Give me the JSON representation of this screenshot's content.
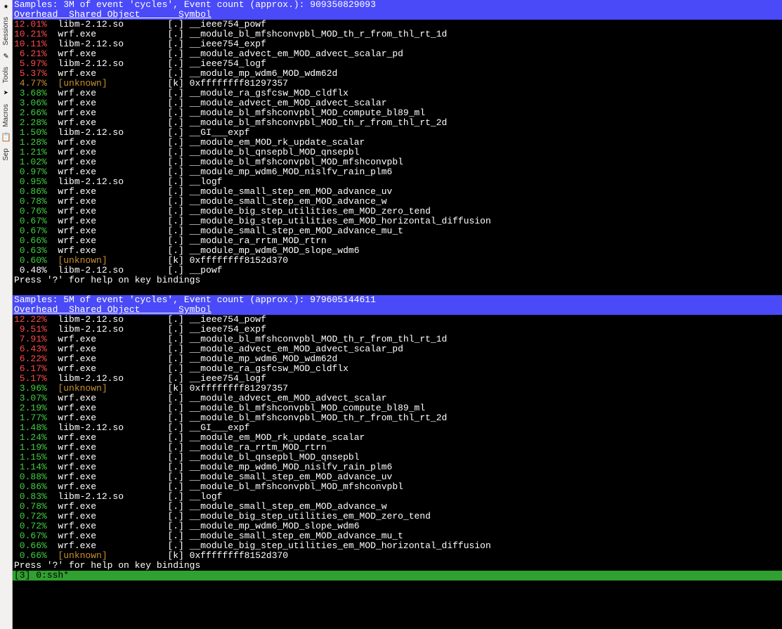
{
  "toolbar": {
    "labels": [
      "Sessions",
      "Tools",
      "Macros",
      "Sep"
    ],
    "icons": [
      "★",
      "✎",
      "➤",
      "📋"
    ]
  },
  "col_header": "Overhead  Shared Object       Symbol",
  "footer": "Press '?' for help on key bindings",
  "status_bar": "[3] 0:ssh*",
  "pane_top": {
    "title": "Samples: 3M of event 'cycles', Event count (approx.): 909350829093",
    "rows": [
      {
        "pct": "12.01%",
        "cls": "r",
        "obj": "libm-2.12.so",
        "oc": "obj",
        "k": ".",
        "sym": "__ieee754_powf"
      },
      {
        "pct": "10.21%",
        "cls": "r",
        "obj": "wrf.exe",
        "oc": "obj",
        "k": ".",
        "sym": "__module_bl_mfshconvpbl_MOD_th_r_from_thl_rt_1d"
      },
      {
        "pct": "10.11%",
        "cls": "r",
        "obj": "libm-2.12.so",
        "oc": "obj",
        "k": ".",
        "sym": "__ieee754_expf"
      },
      {
        "pct": " 6.21%",
        "cls": "r",
        "obj": "wrf.exe",
        "oc": "obj",
        "k": ".",
        "sym": "__module_advect_em_MOD_advect_scalar_pd"
      },
      {
        "pct": " 5.97%",
        "cls": "r",
        "obj": "libm-2.12.so",
        "oc": "obj",
        "k": ".",
        "sym": "__ieee754_logf"
      },
      {
        "pct": " 5.37%",
        "cls": "r",
        "obj": "wrf.exe",
        "oc": "obj",
        "k": ".",
        "sym": "__module_mp_wdm6_MOD_wdm62d"
      },
      {
        "pct": " 4.77%",
        "cls": "o",
        "obj": "[unknown]",
        "oc": "obj-unk",
        "k": "k",
        "sym": "0xffffffff81297357"
      },
      {
        "pct": " 3.68%",
        "cls": "g",
        "obj": "wrf.exe",
        "oc": "obj",
        "k": ".",
        "sym": "__module_ra_gsfcsw_MOD_cldflx"
      },
      {
        "pct": " 3.06%",
        "cls": "g",
        "obj": "wrf.exe",
        "oc": "obj",
        "k": ".",
        "sym": "__module_advect_em_MOD_advect_scalar"
      },
      {
        "pct": " 2.66%",
        "cls": "g",
        "obj": "wrf.exe",
        "oc": "obj",
        "k": ".",
        "sym": "__module_bl_mfshconvpbl_MOD_compute_bl89_ml"
      },
      {
        "pct": " 2.28%",
        "cls": "g",
        "obj": "wrf.exe",
        "oc": "obj",
        "k": ".",
        "sym": "__module_bl_mfshconvpbl_MOD_th_r_from_thl_rt_2d"
      },
      {
        "pct": " 1.50%",
        "cls": "g",
        "obj": "libm-2.12.so",
        "oc": "obj",
        "k": ".",
        "sym": "__GI___expf"
      },
      {
        "pct": " 1.28%",
        "cls": "g",
        "obj": "wrf.exe",
        "oc": "obj",
        "k": ".",
        "sym": "__module_em_MOD_rk_update_scalar"
      },
      {
        "pct": " 1.21%",
        "cls": "g",
        "obj": "wrf.exe",
        "oc": "obj",
        "k": ".",
        "sym": "__module_bl_qnsepbl_MOD_qnsepbl"
      },
      {
        "pct": " 1.02%",
        "cls": "g",
        "obj": "wrf.exe",
        "oc": "obj",
        "k": ".",
        "sym": "__module_bl_mfshconvpbl_MOD_mfshconvpbl"
      },
      {
        "pct": " 0.97%",
        "cls": "g",
        "obj": "wrf.exe",
        "oc": "obj",
        "k": ".",
        "sym": "__module_mp_wdm6_MOD_nislfv_rain_plm6"
      },
      {
        "pct": " 0.95%",
        "cls": "g",
        "obj": "libm-2.12.so",
        "oc": "obj",
        "k": ".",
        "sym": "__logf"
      },
      {
        "pct": " 0.86%",
        "cls": "g",
        "obj": "wrf.exe",
        "oc": "obj",
        "k": ".",
        "sym": "__module_small_step_em_MOD_advance_uv"
      },
      {
        "pct": " 0.78%",
        "cls": "g",
        "obj": "wrf.exe",
        "oc": "obj",
        "k": ".",
        "sym": "__module_small_step_em_MOD_advance_w"
      },
      {
        "pct": " 0.76%",
        "cls": "g",
        "obj": "wrf.exe",
        "oc": "obj",
        "k": ".",
        "sym": "__module_big_step_utilities_em_MOD_zero_tend"
      },
      {
        "pct": " 0.67%",
        "cls": "g",
        "obj": "wrf.exe",
        "oc": "obj",
        "k": ".",
        "sym": "__module_big_step_utilities_em_MOD_horizontal_diffusion"
      },
      {
        "pct": " 0.67%",
        "cls": "g",
        "obj": "wrf.exe",
        "oc": "obj",
        "k": ".",
        "sym": "__module_small_step_em_MOD_advance_mu_t"
      },
      {
        "pct": " 0.66%",
        "cls": "g",
        "obj": "wrf.exe",
        "oc": "obj",
        "k": ".",
        "sym": "__module_ra_rrtm_MOD_rtrn"
      },
      {
        "pct": " 0.63%",
        "cls": "g",
        "obj": "wrf.exe",
        "oc": "obj",
        "k": ".",
        "sym": "__module_mp_wdm6_MOD_slope_wdm6"
      },
      {
        "pct": " 0.60%",
        "cls": "g",
        "obj": "[unknown]",
        "oc": "obj-unk",
        "k": "k",
        "sym": "0xffffffff8152d370"
      },
      {
        "pct": " 0.48%",
        "cls": "w",
        "obj": "libm-2.12.so",
        "oc": "obj",
        "k": ".",
        "sym": "__powf"
      }
    ]
  },
  "pane_bottom": {
    "title": "Samples: 5M of event 'cycles', Event count (approx.): 979605144611",
    "rows": [
      {
        "pct": "12.22%",
        "cls": "r",
        "obj": "libm-2.12.so",
        "oc": "obj",
        "k": ".",
        "sym": "__ieee754_powf"
      },
      {
        "pct": " 9.51%",
        "cls": "r",
        "obj": "libm-2.12.so",
        "oc": "obj",
        "k": ".",
        "sym": "__ieee754_expf"
      },
      {
        "pct": " 7.91%",
        "cls": "r",
        "obj": "wrf.exe",
        "oc": "obj",
        "k": ".",
        "sym": "__module_bl_mfshconvpbl_MOD_th_r_from_thl_rt_1d"
      },
      {
        "pct": " 6.43%",
        "cls": "r",
        "obj": "wrf.exe",
        "oc": "obj",
        "k": ".",
        "sym": "__module_advect_em_MOD_advect_scalar_pd"
      },
      {
        "pct": " 6.22%",
        "cls": "r",
        "obj": "wrf.exe",
        "oc": "obj",
        "k": ".",
        "sym": "__module_mp_wdm6_MOD_wdm62d"
      },
      {
        "pct": " 6.17%",
        "cls": "r",
        "obj": "wrf.exe",
        "oc": "obj",
        "k": ".",
        "sym": "__module_ra_gsfcsw_MOD_cldflx"
      },
      {
        "pct": " 5.17%",
        "cls": "r",
        "obj": "libm-2.12.so",
        "oc": "obj",
        "k": ".",
        "sym": "__ieee754_logf"
      },
      {
        "pct": " 3.96%",
        "cls": "g",
        "obj": "[unknown]",
        "oc": "obj-unk",
        "k": "k",
        "sym": "0xffffffff81297357"
      },
      {
        "pct": " 3.07%",
        "cls": "g",
        "obj": "wrf.exe",
        "oc": "obj",
        "k": ".",
        "sym": "__module_advect_em_MOD_advect_scalar"
      },
      {
        "pct": " 2.19%",
        "cls": "g",
        "obj": "wrf.exe",
        "oc": "obj",
        "k": ".",
        "sym": "__module_bl_mfshconvpbl_MOD_compute_bl89_ml"
      },
      {
        "pct": " 1.77%",
        "cls": "g",
        "obj": "wrf.exe",
        "oc": "obj",
        "k": ".",
        "sym": "__module_bl_mfshconvpbl_MOD_th_r_from_thl_rt_2d"
      },
      {
        "pct": " 1.48%",
        "cls": "g",
        "obj": "libm-2.12.so",
        "oc": "obj",
        "k": ".",
        "sym": "__GI___expf"
      },
      {
        "pct": " 1.24%",
        "cls": "g",
        "obj": "wrf.exe",
        "oc": "obj",
        "k": ".",
        "sym": "__module_em_MOD_rk_update_scalar"
      },
      {
        "pct": " 1.19%",
        "cls": "g",
        "obj": "wrf.exe",
        "oc": "obj",
        "k": ".",
        "sym": "__module_ra_rrtm_MOD_rtrn"
      },
      {
        "pct": " 1.15%",
        "cls": "g",
        "obj": "wrf.exe",
        "oc": "obj",
        "k": ".",
        "sym": "__module_bl_qnsepbl_MOD_qnsepbl"
      },
      {
        "pct": " 1.14%",
        "cls": "g",
        "obj": "wrf.exe",
        "oc": "obj",
        "k": ".",
        "sym": "__module_mp_wdm6_MOD_nislfv_rain_plm6"
      },
      {
        "pct": " 0.88%",
        "cls": "g",
        "obj": "wrf.exe",
        "oc": "obj",
        "k": ".",
        "sym": "__module_small_step_em_MOD_advance_uv"
      },
      {
        "pct": " 0.86%",
        "cls": "g",
        "obj": "wrf.exe",
        "oc": "obj",
        "k": ".",
        "sym": "__module_bl_mfshconvpbl_MOD_mfshconvpbl"
      },
      {
        "pct": " 0.83%",
        "cls": "g",
        "obj": "libm-2.12.so",
        "oc": "obj",
        "k": ".",
        "sym": "__logf"
      },
      {
        "pct": " 0.78%",
        "cls": "g",
        "obj": "wrf.exe",
        "oc": "obj",
        "k": ".",
        "sym": "__module_small_step_em_MOD_advance_w"
      },
      {
        "pct": " 0.72%",
        "cls": "g",
        "obj": "wrf.exe",
        "oc": "obj",
        "k": ".",
        "sym": "__module_big_step_utilities_em_MOD_zero_tend"
      },
      {
        "pct": " 0.72%",
        "cls": "g",
        "obj": "wrf.exe",
        "oc": "obj",
        "k": ".",
        "sym": "__module_mp_wdm6_MOD_slope_wdm6"
      },
      {
        "pct": " 0.67%",
        "cls": "g",
        "obj": "wrf.exe",
        "oc": "obj",
        "k": ".",
        "sym": "__module_small_step_em_MOD_advance_mu_t"
      },
      {
        "pct": " 0.66%",
        "cls": "g",
        "obj": "wrf.exe",
        "oc": "obj",
        "k": ".",
        "sym": "__module_big_step_utilities_em_MOD_horizontal_diffusion"
      },
      {
        "pct": " 0.66%",
        "cls": "g",
        "obj": "[unknown]",
        "oc": "obj-unk",
        "k": "k",
        "sym": "0xffffffff8152d370"
      }
    ]
  }
}
